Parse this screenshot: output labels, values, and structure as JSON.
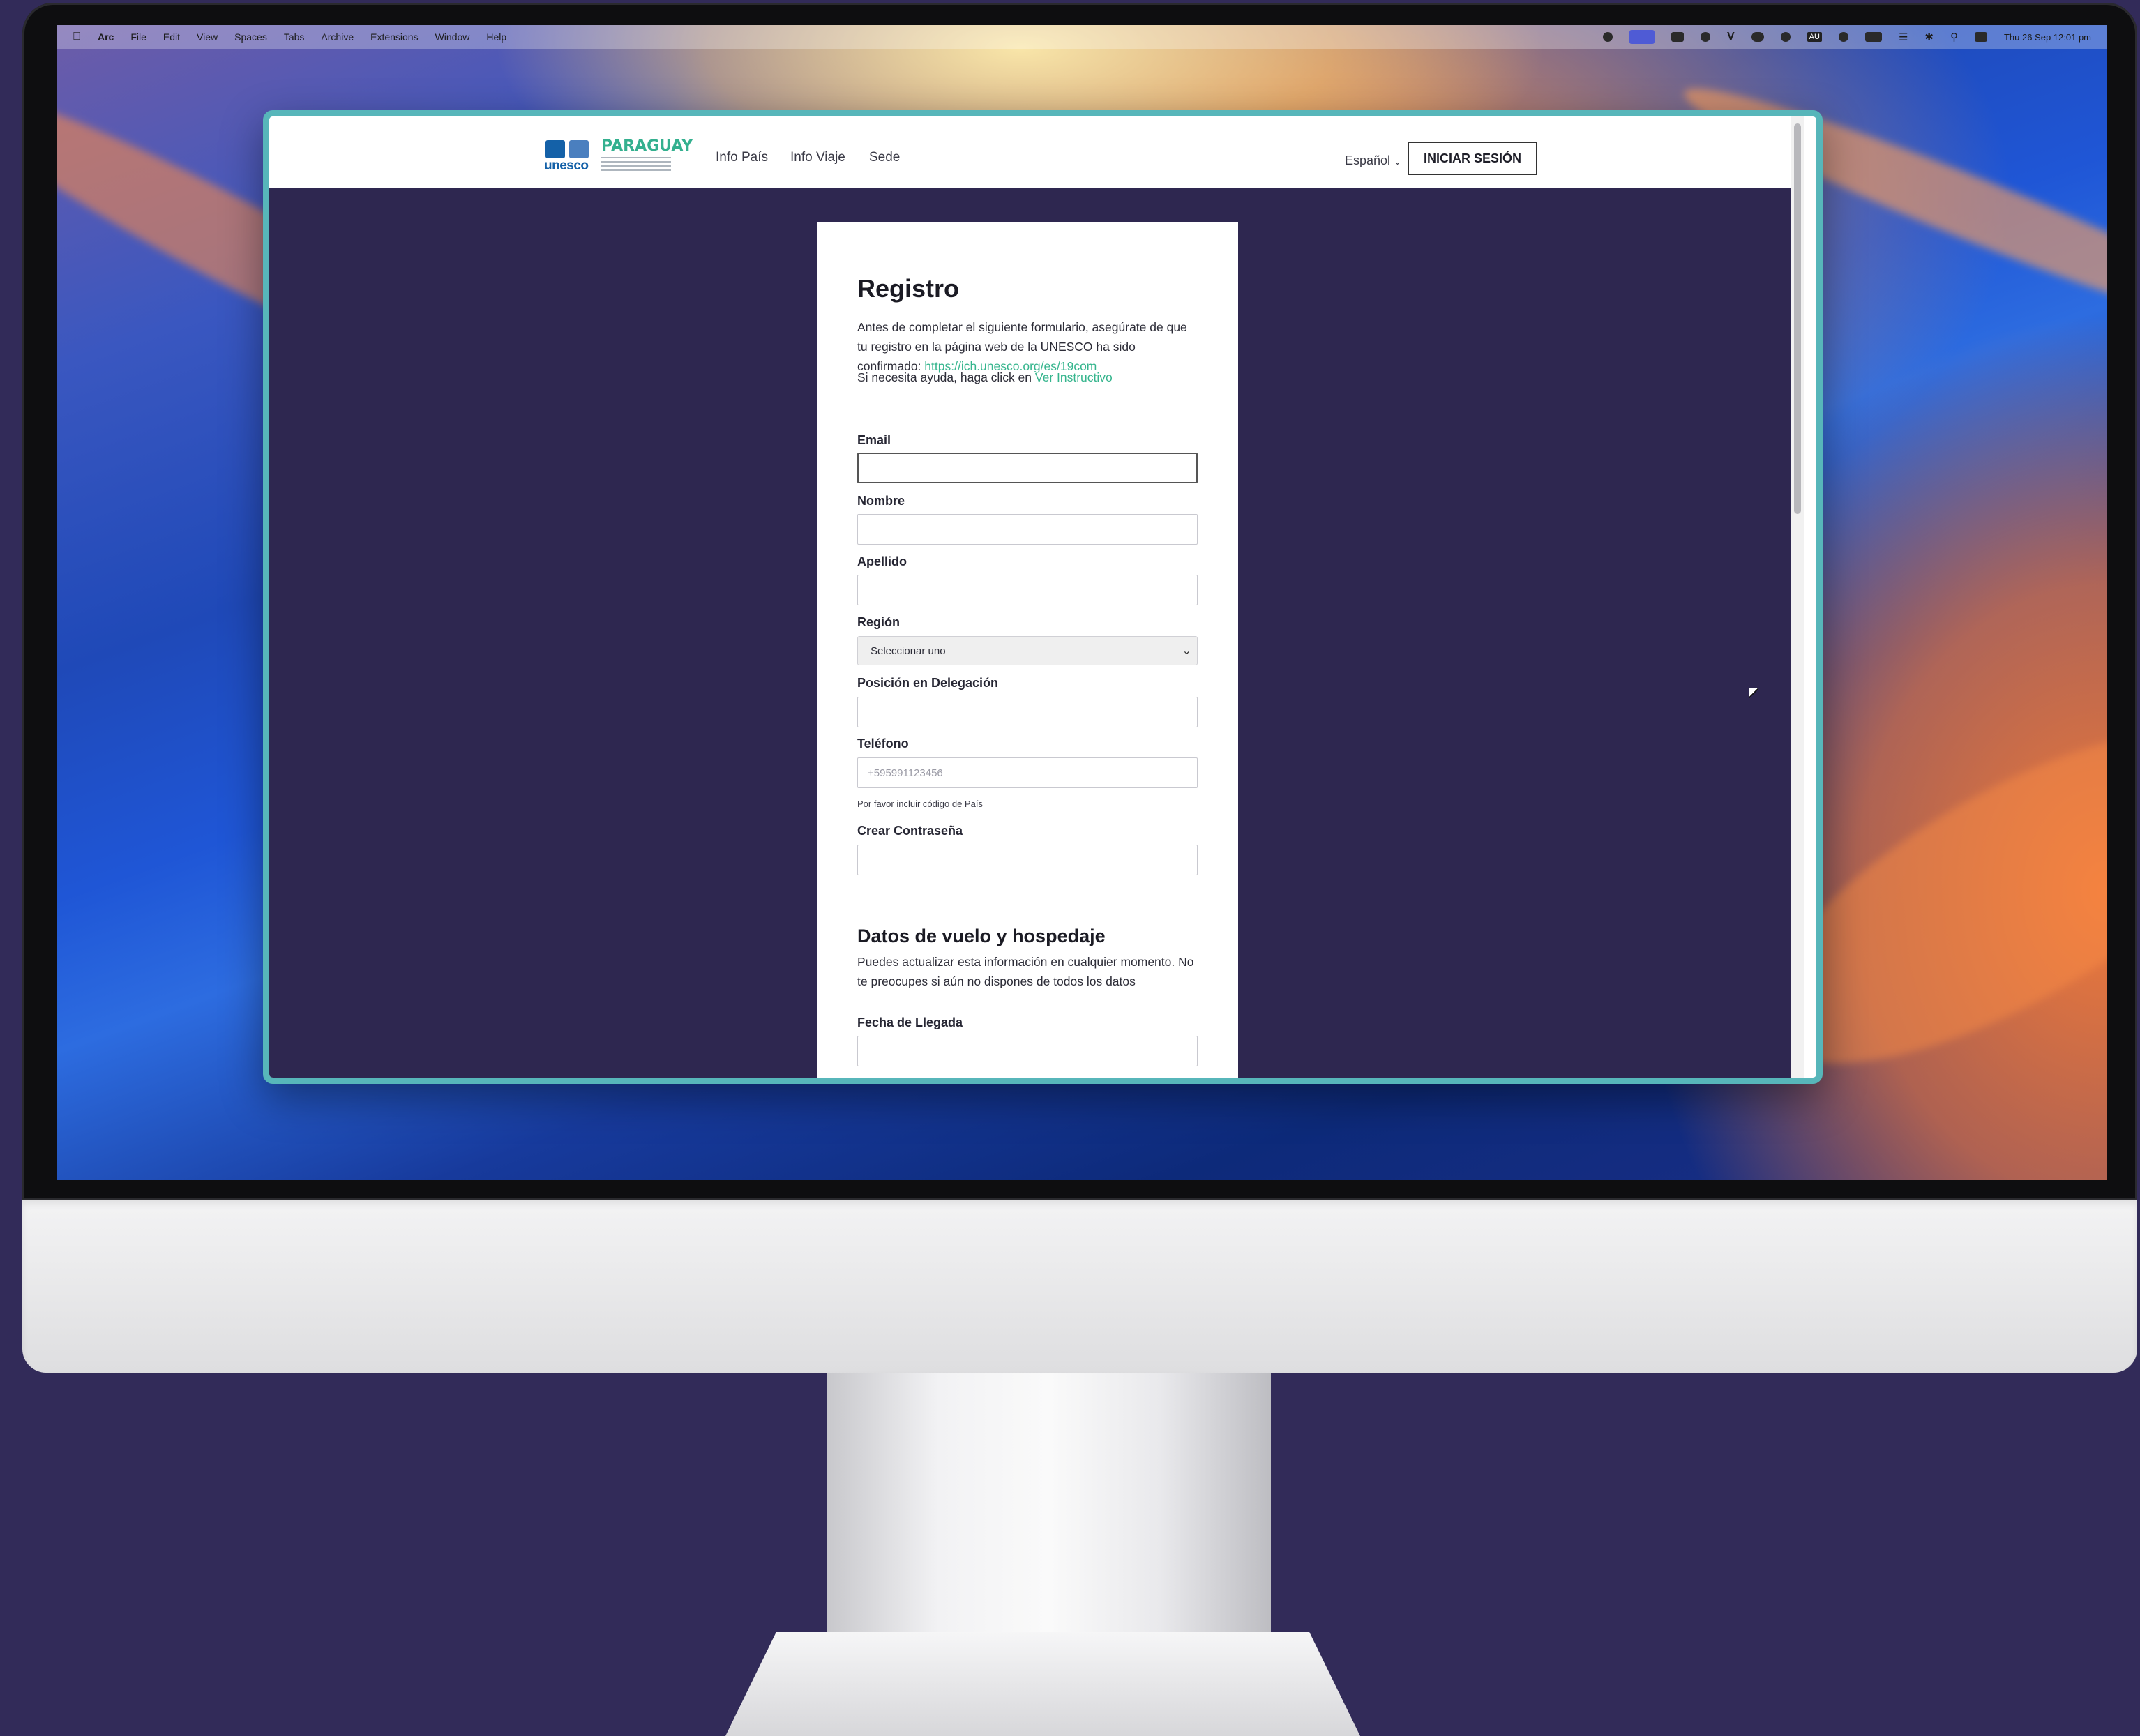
{
  "menubar": {
    "app": "Arc",
    "items": [
      "File",
      "Edit",
      "View",
      "Spaces",
      "Tabs",
      "Archive",
      "Extensions",
      "Window",
      "Help"
    ],
    "clock": "Thu 26 Sep  12:01 pm",
    "input_source": "AU"
  },
  "site": {
    "logo_text": "unesco",
    "brand": "PARAGUAY",
    "nav": [
      "Info País",
      "Info Viaje",
      "Sede"
    ],
    "language": "Español",
    "login_label": "INICIAR SESIÓN"
  },
  "form": {
    "title": "Registro",
    "intro_text": "Antes de completar el siguiente formulario, asegúrate de que tu registro en la página web de la UNESCO ha sido confirmado: ",
    "intro_link": "https://ich.unesco.org/es/19com",
    "help_text": "Si necesita ayuda, haga click en ",
    "help_link": "Ver Instructivo",
    "fields": {
      "email": {
        "label": "Email",
        "value": ""
      },
      "nombre": {
        "label": "Nombre",
        "value": ""
      },
      "apellido": {
        "label": "Apellido",
        "value": ""
      },
      "region": {
        "label": "Región",
        "selected": "Seleccionar uno"
      },
      "posicion": {
        "label": "Posición en Delegación",
        "value": ""
      },
      "telefono": {
        "label": "Teléfono",
        "placeholder": "+595991123456",
        "hint": "Por favor incluir código de País"
      },
      "password": {
        "label": "Crear Contraseña",
        "value": ""
      }
    },
    "section2": {
      "title": "Datos de vuelo y hospedaje",
      "text": "Puedes actualizar esta información en cualquier momento. No te preocupes si aún no dispones de todos los datos",
      "fecha_label": "Fecha de Llegada"
    }
  },
  "colors": {
    "page_bg": "#2e2750",
    "accent_link": "#35b58d",
    "window_border": "#57b6ba",
    "brand_green": "#34b08f",
    "unesco_blue": "#1461a8"
  }
}
